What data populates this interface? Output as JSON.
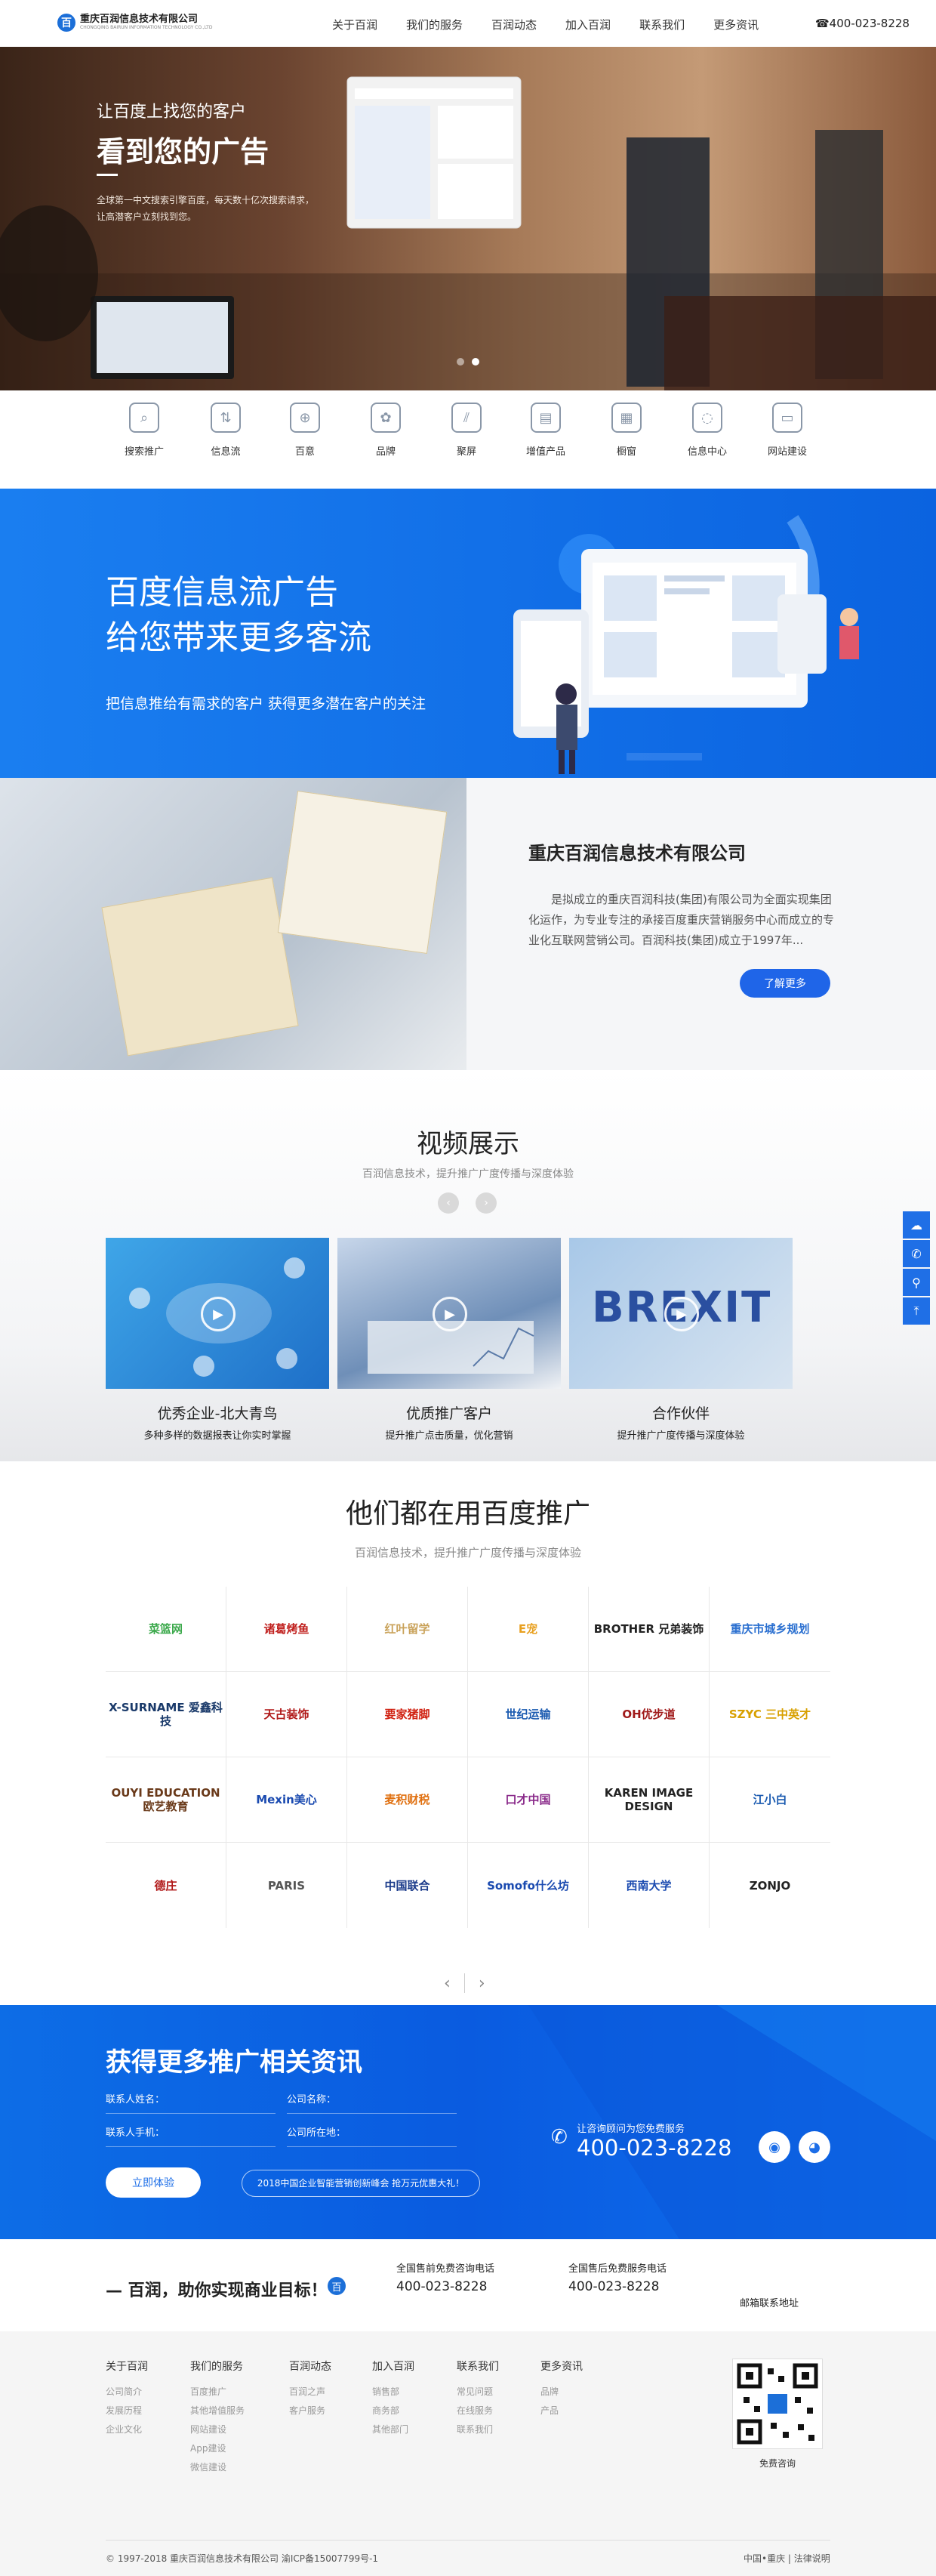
{
  "header": {
    "logo_mark": "百",
    "company": "重庆百润信息技术有限公司",
    "company_en": "CHONGQING BAIRUN INFORMATION TECHNOLOGY CO.,LTD",
    "nav": [
      "关于百润",
      "我们的服务",
      "百润动态",
      "加入百润",
      "联系我们",
      "更多资讯"
    ],
    "phone": "☎400-023-8228"
  },
  "banner": {
    "subtitle": "让百度上找您的客户",
    "title": "看到您的广告",
    "desc": "全球第一中文搜索引擎百度，每天数十亿次搜索请求，让高潜客户立刻找到您。",
    "dots": 2,
    "active_dot": 2
  },
  "services": [
    {
      "label": "搜索推广",
      "icon": "search-icon"
    },
    {
      "label": "信息流",
      "icon": "feed-icon"
    },
    {
      "label": "百意",
      "icon": "crosshair-icon"
    },
    {
      "label": "品牌",
      "icon": "brand-icon"
    },
    {
      "label": "聚屏",
      "icon": "screen-icon"
    },
    {
      "label": "增值产品",
      "icon": "clipboard-icon"
    },
    {
      "label": "橱窗",
      "icon": "window-icon"
    },
    {
      "label": "信息中心",
      "icon": "lightbulb-icon"
    },
    {
      "label": "网站建设",
      "icon": "monitor-icon"
    }
  ],
  "feed": {
    "title_line1": "百度信息流广告",
    "title_line2": "给您带来更多客流",
    "desc": "把信息推给有需求的客户 获得更多潜在客户的关注"
  },
  "about": {
    "title": "重庆百润信息技术有限公司",
    "text": "是拟成立的重庆百润科技(集团)有限公司为全面实现集团化运作，为专业专注的承接百度重庆营销服务中心而成立的专业化互联网营销公司。百润科技(集团)成立于1997年...",
    "button": "了解更多"
  },
  "video": {
    "title": "视频展示",
    "subtitle": "百润信息技术，提升推广广度传播与深度体验",
    "cards": [
      {
        "title": "优秀企业-北大青鸟",
        "desc": "多种多样的数据报表让你实时掌握"
      },
      {
        "title": "优质推广客户",
        "desc": "提升推广点击质量，优化营销"
      },
      {
        "title": "合作伙伴",
        "desc": "提升推广广度传播与深度体验"
      }
    ],
    "third_image_text": "BREXIT"
  },
  "clients": {
    "title": "他们都在用百度推广",
    "subtitle": "百润信息技术，提升推广广度传播与深度体验",
    "logos": [
      {
        "text": "菜篮网",
        "color": "#3aa84a"
      },
      {
        "text": "诸葛烤鱼",
        "color": "#c0201e"
      },
      {
        "text": "红叶留学",
        "color": "#c9a25a"
      },
      {
        "text": "E宠",
        "color": "#e8a020"
      },
      {
        "text": "BROTHER 兄弟装饰",
        "color": "#222222"
      },
      {
        "text": "重庆市城乡规划",
        "color": "#2a6fd0"
      },
      {
        "text": "X-SURNAME 爱鑫科技",
        "color": "#1a3a6a"
      },
      {
        "text": "天古装饰",
        "color": "#b01818"
      },
      {
        "text": "要家猪脚",
        "color": "#d02010"
      },
      {
        "text": "世纪运输",
        "color": "#1a5ab0"
      },
      {
        "text": "ОН优步道",
        "color": "#a01a1a"
      },
      {
        "text": "SZYC 三中英才",
        "color": "#d8a000"
      },
      {
        "text": "OUYI EDUCATION 欧艺教育",
        "color": "#6a3a1a"
      },
      {
        "text": "Mexin美心",
        "color": "#1a4ab0"
      },
      {
        "text": "麦积财税",
        "color": "#e07010"
      },
      {
        "text": "口才中国",
        "color": "#8a2a8a"
      },
      {
        "text": "KAREN IMAGE DESIGN",
        "color": "#222222"
      },
      {
        "text": "江小白",
        "color": "#1a5ab0"
      },
      {
        "text": "德庄",
        "color": "#b01818"
      },
      {
        "text": "PARIS",
        "color": "#555555"
      },
      {
        "text": "中国联合",
        "color": "#1a3a8a"
      },
      {
        "text": "Somofo什么坊",
        "color": "#1a4ab0"
      },
      {
        "text": "西南大学",
        "color": "#1a4ab0"
      },
      {
        "text": "ZONJO",
        "color": "#222222"
      }
    ]
  },
  "consult": {
    "title": "获得更多推广相关资讯",
    "fields": [
      "联系人姓名：",
      "公司名称：",
      "联系人手机：",
      "公司所在地："
    ],
    "button": "立即体验",
    "notice": "2018中国企业智能营销创新峰会 抢万元优惠大礼！",
    "phone_label": "让咨询顾问为您免费服务",
    "phone": "400-023-8228"
  },
  "goal": {
    "slogan": "— 百润，助你实现商业目标！",
    "phones": [
      {
        "label": "全国售前免费咨询电话",
        "number": "400-023-8228"
      },
      {
        "label": "全国售后免费服务电话",
        "number": "400-023-8228"
      }
    ],
    "addr": "邮箱联系地址"
  },
  "footer": {
    "columns": [
      {
        "head": "关于百润",
        "items": [
          "公司简介",
          "发展历程",
          "企业文化"
        ]
      },
      {
        "head": "我们的服务",
        "items": [
          "百度推广",
          "其他增值服务",
          "网站建设",
          "App建设",
          "微信建设"
        ]
      },
      {
        "head": "百润动态",
        "items": [
          "百润之声",
          "客户服务"
        ]
      },
      {
        "head": "加入百润",
        "items": [
          "销售部",
          "商务部",
          "其他部门"
        ]
      },
      {
        "head": "联系我们",
        "items": [
          "常见问题",
          "在线服务",
          "联系我们"
        ]
      },
      {
        "head": "更多资讯",
        "items": [
          "品牌",
          "产品"
        ]
      }
    ],
    "qr_label": "免费咨询",
    "copyright": "© 1997-2018 重庆百润信息技术有限公司 渝ICP备15007799号-1",
    "location": "中国•重庆 | 法律说明"
  },
  "side": [
    "chat-icon",
    "phone-icon",
    "location-icon",
    "back-to-top-icon"
  ],
  "colors": {
    "brand_blue": "#1f6fe6",
    "text_dark": "#222222"
  }
}
